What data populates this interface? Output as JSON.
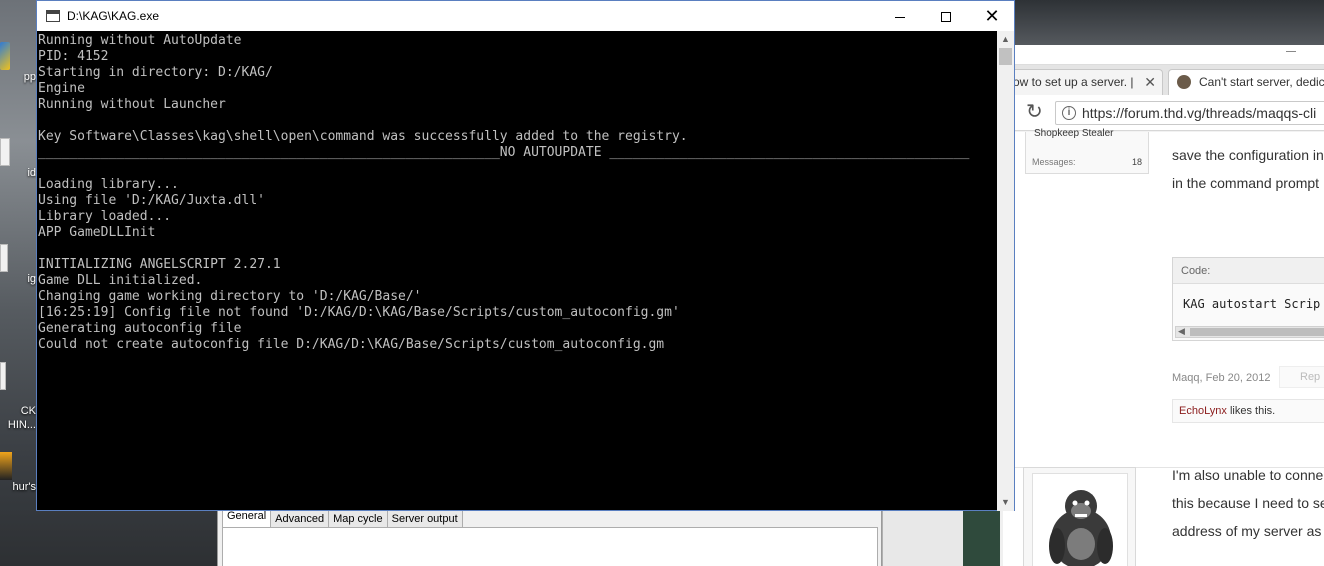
{
  "desktop": {
    "icons": [
      {
        "label": "pp",
        "icon": "app-shortcut-icon"
      },
      {
        "label": "id",
        "icon": "document-icon"
      },
      {
        "label": "ig",
        "icon": "document-icon"
      },
      {
        "label": "CK\nHIN...",
        "icon": "document-icon"
      },
      {
        "label": "hur's",
        "icon": "game-shortcut-icon"
      }
    ]
  },
  "kag_config": {
    "tabs": [
      "General",
      "Advanced",
      "Map cycle",
      "Server output"
    ],
    "active_tab": "General"
  },
  "browser": {
    "tabs": [
      {
        "label": "ow to set up a server. |",
        "icon": "page-icon"
      },
      {
        "label": "Can't start server, dedic",
        "icon": "forum-favicon"
      }
    ],
    "url": "https://forum.thd.vg/threads/maqqs-cli",
    "post1": {
      "user_title": "Shopkeep Stealer",
      "messages_label": "Messages:",
      "messages_value": "18",
      "text_lines": [
        "save the configuration in",
        "in the command prompt"
      ],
      "code_label": "Code:",
      "code_text": "KAG autostart Scrip",
      "author_date": "Maqq, Feb 20, 2012",
      "reply_label": "Rep",
      "liker": "EchoLynx",
      "likes_suffix": " likes this."
    },
    "post2": {
      "text_lines": [
        "I'm also unable to conne",
        "this because I need to se",
        "address of my server as"
      ]
    }
  },
  "console": {
    "title": "D:\\KAG\\KAG.exe",
    "lines": [
      "Running without AutoUpdate",
      "PID: 4152",
      "Starting in directory: D:/KAG/",
      "Engine",
      "Running without Launcher",
      "",
      "Key Software\\Classes\\kag\\shell\\open\\command was successfully added to the registry.",
      "___________________________________________________________NO AUTOUPDATE ______________________________________________",
      "",
      "Loading library...",
      "Using file 'D:/KAG/Juxta.dll'",
      "Library loaded...",
      "APP GameDLLInit",
      "",
      "INITIALIZING ANGELSCRIPT 2.27.1",
      "Game DLL initialized.",
      "Changing game working directory to 'D:/KAG/Base/'",
      "[16:25:19] Config file not found 'D:/KAG/D:\\KAG/Base/Scripts/custom_autoconfig.gm'",
      "Generating autoconfig file",
      "Could not create autoconfig file D:/KAG/D:\\KAG/Base/Scripts/custom_autoconfig.gm"
    ],
    "buttons": {
      "minimize": "minimize",
      "maximize": "maximize",
      "close": "✕"
    }
  }
}
